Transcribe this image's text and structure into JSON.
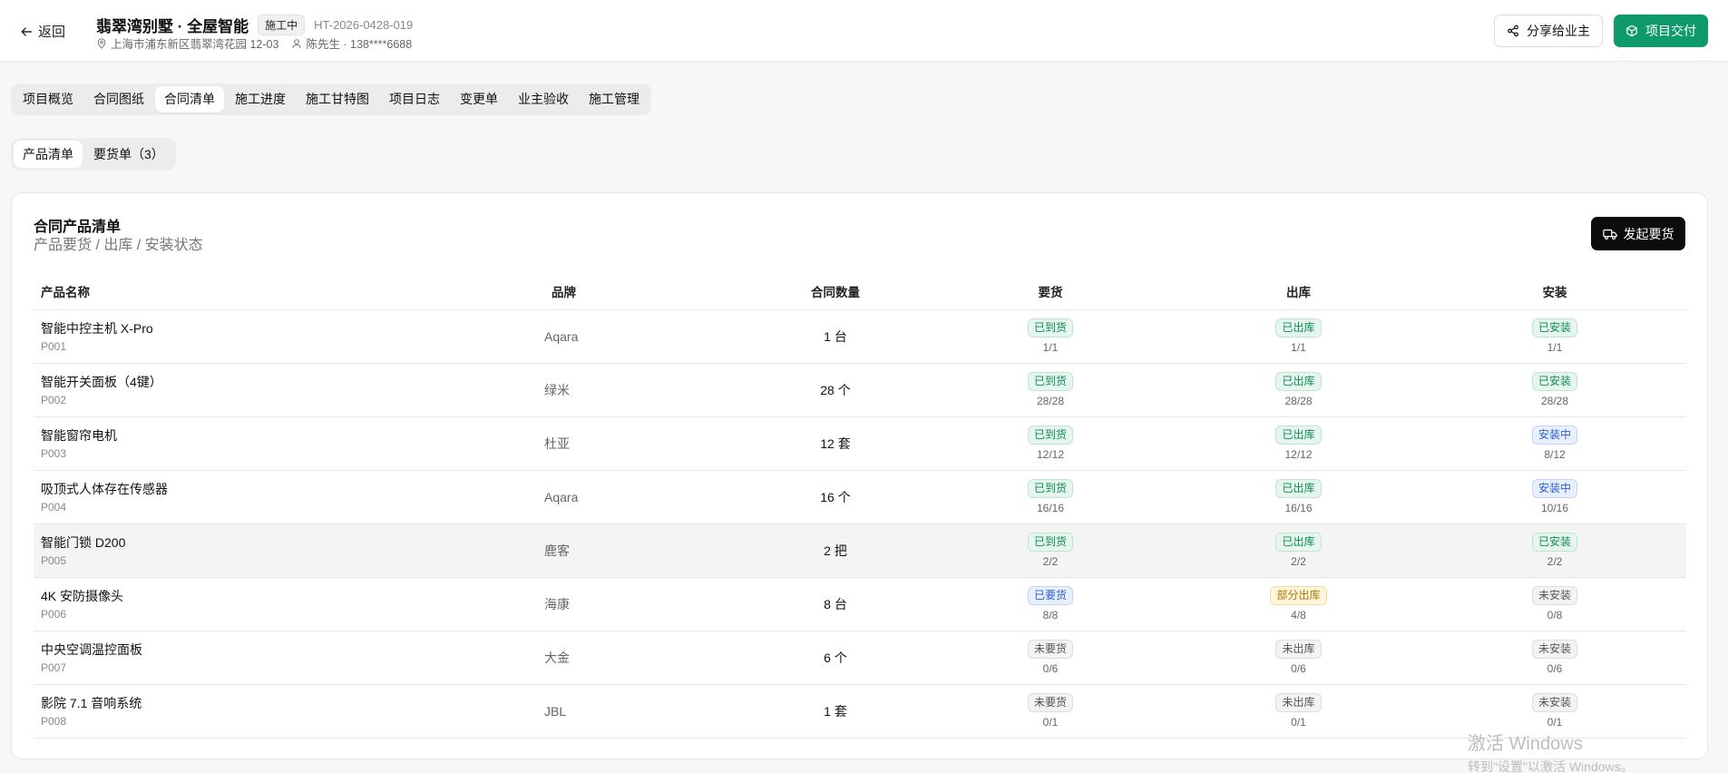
{
  "header": {
    "back_label": "返回",
    "project_name": "翡翠湾别墅 · 全屋智能",
    "status": "施工中",
    "code": "HT-2026-0428-019",
    "address": "上海市浦东新区翡翠湾花园 12-03",
    "owner": "陈先生 · 138****6688",
    "share_label": "分享给业主",
    "deliver_label": "项目交付",
    "accent_color": "#0f9a6b"
  },
  "tabs": [
    {
      "label": "项目概览"
    },
    {
      "label": "合同图纸"
    },
    {
      "label": "合同清单",
      "active": true
    },
    {
      "label": "施工进度"
    },
    {
      "label": "施工甘特图"
    },
    {
      "label": "项目日志"
    },
    {
      "label": "变更单"
    },
    {
      "label": "业主验收"
    },
    {
      "label": "施工管理"
    }
  ],
  "subtabs": [
    {
      "label": "产品清单",
      "active": true
    },
    {
      "label": "要货单（3）"
    }
  ],
  "card": {
    "title": "合同产品清单",
    "subtitle": "产品要货 / 出库 / 安装状态",
    "request_label": "发起要货",
    "columns": [
      "产品名称",
      "品牌",
      "合同数量",
      "要货",
      "出库",
      "安装"
    ],
    "rows": [
      {
        "name": "智能中控主机 X-Pro",
        "code": "P001",
        "brand": "Aqara",
        "qty": "1 台",
        "req": {
          "label": "已到货",
          "frac": "1/1",
          "tone": "green"
        },
        "out": {
          "label": "已出库",
          "frac": "1/1",
          "tone": "green"
        },
        "inst": {
          "label": "已安装",
          "frac": "1/1",
          "tone": "green"
        }
      },
      {
        "name": "智能开关面板（4键）",
        "code": "P002",
        "brand": "绿米",
        "qty": "28 个",
        "req": {
          "label": "已到货",
          "frac": "28/28",
          "tone": "green"
        },
        "out": {
          "label": "已出库",
          "frac": "28/28",
          "tone": "green"
        },
        "inst": {
          "label": "已安装",
          "frac": "28/28",
          "tone": "green"
        }
      },
      {
        "name": "智能窗帘电机",
        "code": "P003",
        "brand": "杜亚",
        "qty": "12 套",
        "req": {
          "label": "已到货",
          "frac": "12/12",
          "tone": "green"
        },
        "out": {
          "label": "已出库",
          "frac": "12/12",
          "tone": "green"
        },
        "inst": {
          "label": "安装中",
          "frac": "8/12",
          "tone": "blue"
        }
      },
      {
        "name": "吸顶式人体存在传感器",
        "code": "P004",
        "brand": "Aqara",
        "qty": "16 个",
        "req": {
          "label": "已到货",
          "frac": "16/16",
          "tone": "green"
        },
        "out": {
          "label": "已出库",
          "frac": "16/16",
          "tone": "green"
        },
        "inst": {
          "label": "安装中",
          "frac": "10/16",
          "tone": "blue"
        }
      },
      {
        "name": "智能门锁 D200",
        "code": "P005",
        "brand": "鹿客",
        "qty": "2 把",
        "highlight": true,
        "req": {
          "label": "已到货",
          "frac": "2/2",
          "tone": "green"
        },
        "out": {
          "label": "已出库",
          "frac": "2/2",
          "tone": "green"
        },
        "inst": {
          "label": "已安装",
          "frac": "2/2",
          "tone": "green"
        }
      },
      {
        "name": "4K 安防摄像头",
        "code": "P006",
        "brand": "海康",
        "qty": "8 台",
        "req": {
          "label": "已要货",
          "frac": "8/8",
          "tone": "blue"
        },
        "out": {
          "label": "部分出库",
          "frac": "4/8",
          "tone": "amber"
        },
        "inst": {
          "label": "未安装",
          "frac": "0/8",
          "tone": "gray"
        }
      },
      {
        "name": "中央空调温控面板",
        "code": "P007",
        "brand": "大金",
        "qty": "6 个",
        "req": {
          "label": "未要货",
          "frac": "0/6",
          "tone": "gray"
        },
        "out": {
          "label": "未出库",
          "frac": "0/6",
          "tone": "gray"
        },
        "inst": {
          "label": "未安装",
          "frac": "0/6",
          "tone": "gray"
        }
      },
      {
        "name": "影院 7.1 音响系统",
        "code": "P008",
        "brand": "JBL",
        "qty": "1 套",
        "req": {
          "label": "未要货",
          "frac": "0/1",
          "tone": "gray"
        },
        "out": {
          "label": "未出库",
          "frac": "0/1",
          "tone": "gray"
        },
        "inst": {
          "label": "未安装",
          "frac": "0/1",
          "tone": "gray"
        }
      }
    ]
  },
  "watermark": {
    "line1": "激活 Windows",
    "line2": "转到\"设置\"以激活 Windows。"
  }
}
